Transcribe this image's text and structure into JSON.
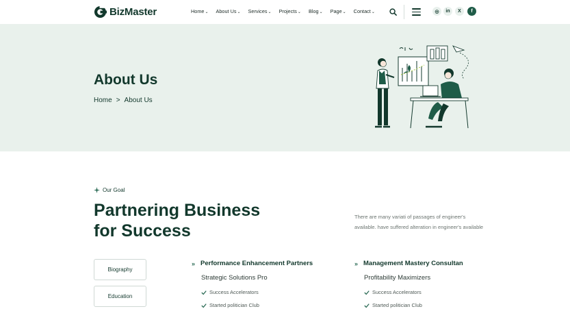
{
  "brand": {
    "name": "BizMaster"
  },
  "nav": {
    "items": [
      {
        "label": "Home"
      },
      {
        "label": "About Us"
      },
      {
        "label": "Services"
      },
      {
        "label": "Projects"
      },
      {
        "label": "Blog"
      },
      {
        "label": "Page"
      },
      {
        "label": "Contact"
      }
    ]
  },
  "social": {
    "instagram": "◎",
    "linkedin": "in",
    "x": "X",
    "facebook": "f"
  },
  "hero": {
    "title": "About Us",
    "breadcrumb": {
      "home": "Home",
      "separator": ">",
      "current": "About Us"
    }
  },
  "goal": {
    "tag": "Our Goal",
    "title_line1": "Partnering Business",
    "title_line2": "for Success",
    "description": "There are many variati of passages of engineer's available.  have suffered alteration in engineer's available"
  },
  "tabs": [
    {
      "label": "Biography"
    },
    {
      "label": "Education"
    }
  ],
  "features": [
    {
      "title": "Performance Enhancement Partners",
      "subtitle": "Strategic Solutions Pro",
      "items": [
        "Success Accelerators",
        "Started politician Club"
      ]
    },
    {
      "title": "Management Mastery Consultan",
      "subtitle": "Profitability Maximizers",
      "items": [
        "Success Accelerators",
        "Started politician Club"
      ]
    }
  ],
  "colors": {
    "primary": "#12382c",
    "hero_bg": "#e9f1ec",
    "accent": "#1f5c48"
  }
}
